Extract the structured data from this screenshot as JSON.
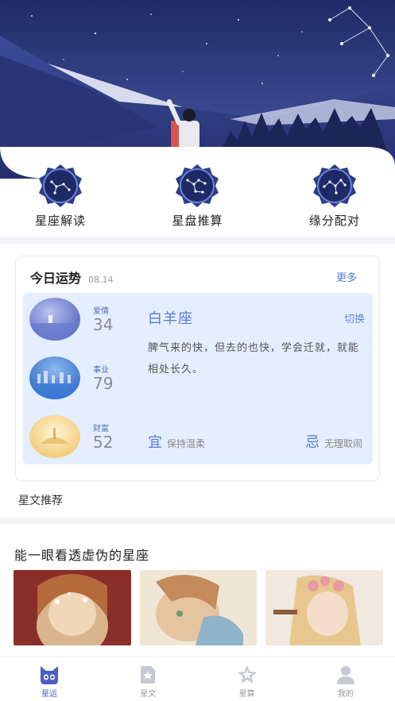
{
  "menu": [
    {
      "label": "星座解读",
      "icon": "constellation-badge-icon"
    },
    {
      "label": "星盘推算",
      "icon": "constellation-badge-icon"
    },
    {
      "label": "缘分配对",
      "icon": "constellation-badge-icon"
    }
  ],
  "fortune": {
    "title": "今日运势",
    "date": "08.14",
    "more": "更多",
    "sign": "白羊座",
    "switch": "切换",
    "description": "脾气来的快，但去的也快，学会迁就，就能相处长久。",
    "stats": [
      {
        "label": "爱情",
        "value": "34"
      },
      {
        "label": "事业",
        "value": "79"
      },
      {
        "label": "财富",
        "value": "52"
      }
    ],
    "yi_char": "宜",
    "yi_text": "保持温柔",
    "ji_char": "忌",
    "ji_text": "无理取闹"
  },
  "section_star": "星文推荐",
  "article": {
    "title": "能一眼看透虚伪的星座"
  },
  "tabs": [
    {
      "label": "星运",
      "icon": "cat-face-icon",
      "active": true
    },
    {
      "label": "星文",
      "icon": "document-star-icon",
      "active": false
    },
    {
      "label": "星算",
      "icon": "star-outline-icon",
      "active": false
    },
    {
      "label": "我的",
      "icon": "person-icon",
      "active": false
    }
  ],
  "colors": {
    "accent": "#5b7bd6",
    "night_sky": "#2d3a78",
    "panel_bg": "#e4eefe",
    "tab_active": "#4b5fc4"
  }
}
